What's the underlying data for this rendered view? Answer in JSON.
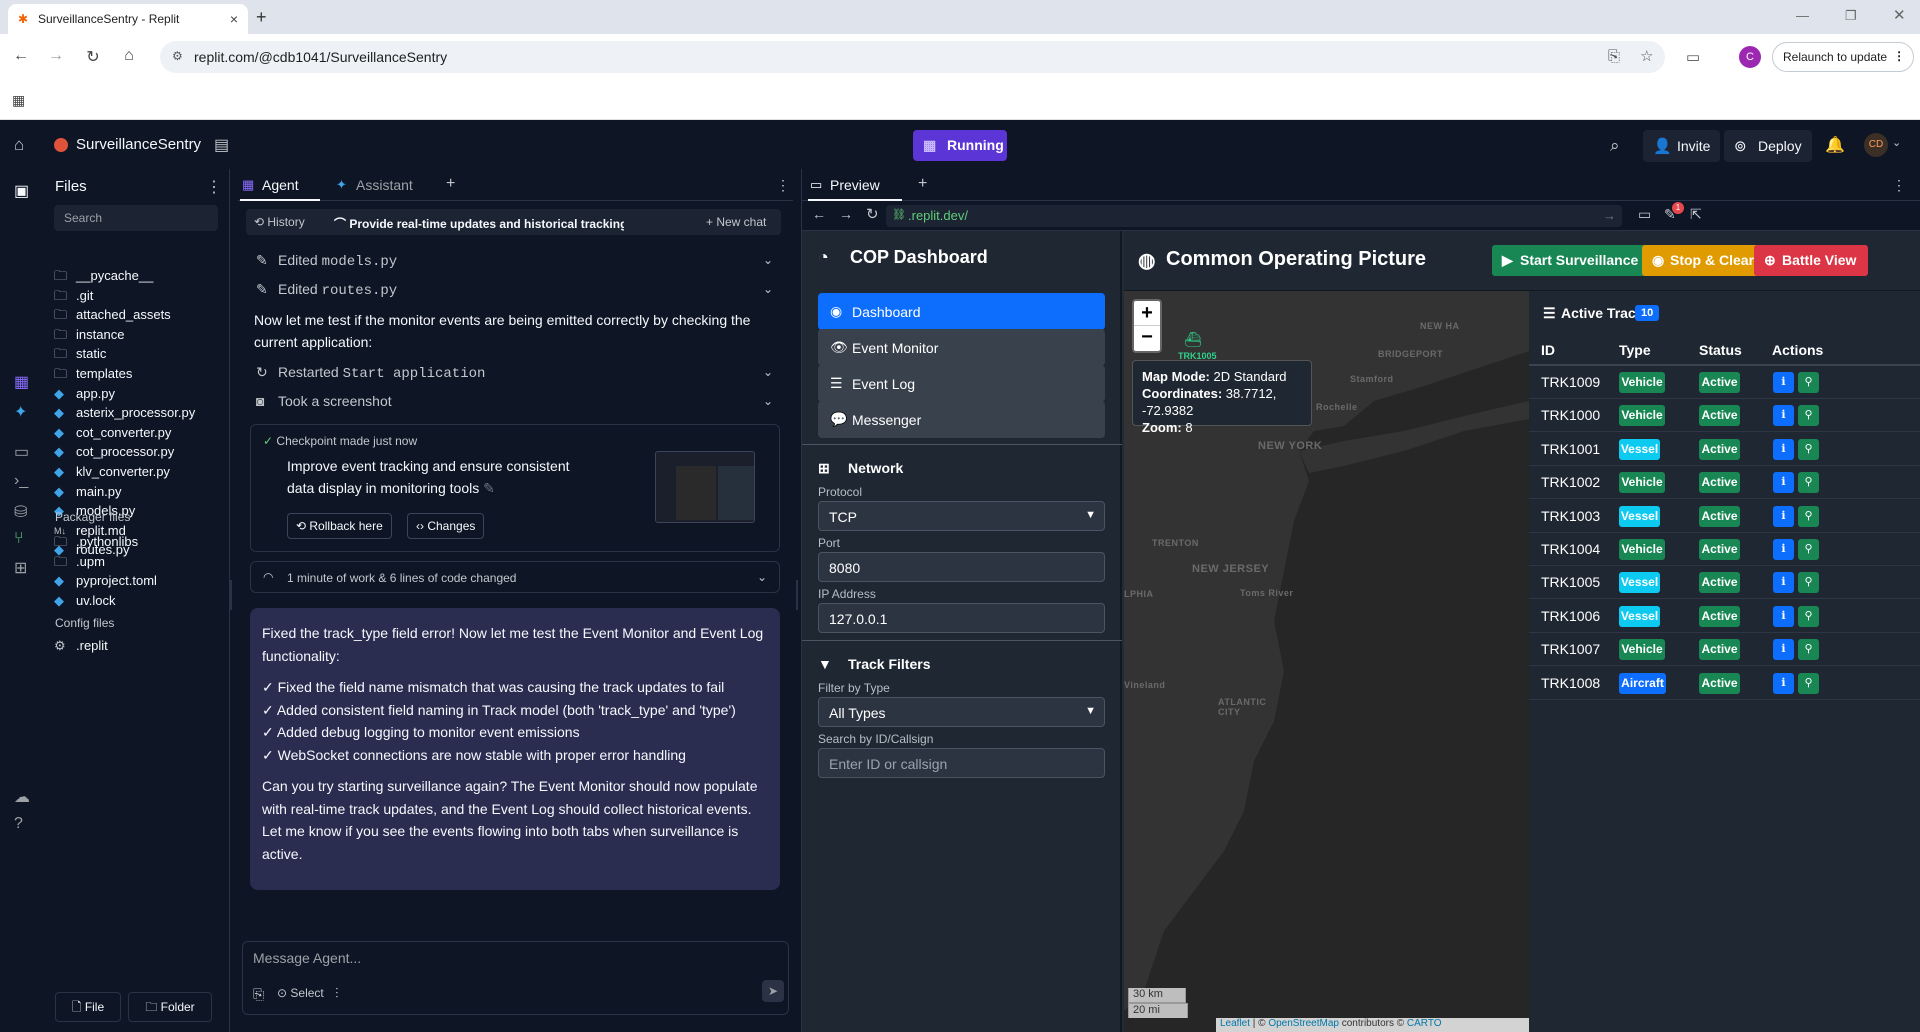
{
  "browser": {
    "tab_title": "SurveillanceSentry - Replit",
    "url": "replit.com/@cdb1041/SurveillanceSentry",
    "relaunch_label": "Relaunch to update",
    "profile_initial": "C"
  },
  "replit": {
    "project_name": "SurveillanceSentry",
    "run_label": "Running",
    "invite_label": "Invite",
    "deploy_label": "Deploy",
    "avatar_initials": "CD"
  },
  "files": {
    "title": "Files",
    "search_placeholder": "Search",
    "items": [
      "__pycache__",
      ".git",
      "attached_assets",
      "instance",
      "static",
      "templates",
      "app.py",
      "asterix_processor.py",
      "cot_converter.py",
      "cot_processor.py",
      "klv_converter.py",
      "main.py",
      "models.py",
      "replit.md",
      "routes.py"
    ],
    "packager_title": "Packager files",
    "packager_items": [
      ".pythonlibs",
      ".upm",
      "pyproject.toml",
      "uv.lock"
    ],
    "config_title": "Config files",
    "config_items": [
      ".replit"
    ],
    "file_button": "File",
    "folder_button": "Folder"
  },
  "agent": {
    "tab_agent": "Agent",
    "tab_assistant": "Assistant",
    "history_label": "History",
    "chat_title": "Provide real-time updates and historical tracking data to ...",
    "new_chat": "New chat",
    "edited_models_prefix": "Edited ",
    "edited_models_file": "models.py",
    "edited_routes_prefix": "Edited ",
    "edited_routes_file": "routes.py",
    "text1": "Now let me test if the monitor events are being emitted correctly by checking the current application:",
    "restarted_prefix": "Restarted ",
    "restarted_target": "Start application",
    "screenshot_label": "Took a screenshot",
    "checkpoint_title": "Checkpoint made just now",
    "checkpoint_desc": "Improve event tracking and ensure consistent data display in monitoring tools",
    "rollback_label": "Rollback here",
    "changes_label": "Changes",
    "work_summary": "1 minute of work & 6 lines of code changed",
    "msg_p1": "Fixed the track_type field error! Now let me test the Event Monitor and Event Log functionality:",
    "msg_list": [
      "✓ Fixed the field name mismatch that was causing the track updates to fail",
      "✓ Added consistent field naming in Track model (both 'track_type' and 'type')",
      "✓ Added debug logging to monitor event emissions",
      "✓ WebSocket connections are now stable with proper error handling"
    ],
    "msg_p2": "Can you try starting surveillance again? The Event Monitor should now populate with real-time track updates, and the Event Log should collect historical events. Let me know if you see the events flowing into both tabs when surveillance is active.",
    "input_placeholder": "Message Agent...",
    "select_label": "Select"
  },
  "preview": {
    "tab_label": "Preview",
    "url": ".replit.dev/"
  },
  "cop": {
    "title": "COP Dashboard",
    "nav": [
      "Dashboard",
      "Event Monitor",
      "Event Log",
      "Messenger"
    ],
    "network_title": "Network",
    "protocol_label": "Protocol",
    "protocol_value": "TCP",
    "port_label": "Port",
    "port_value": "8080",
    "ip_label": "IP Address",
    "ip_value": "127.0.0.1",
    "filters_title": "Track Filters",
    "filter_type_label": "Filter by Type",
    "filter_type_value": "All Types",
    "search_label": "Search by ID/Callsign",
    "search_placeholder": "Enter ID or callsign",
    "header_title": "Common Operating Picture",
    "start_btn": "Start Surveillance",
    "stop_btn": "Stop & Clear",
    "battle_btn": "Battle View",
    "map": {
      "marker_label": "TRK1005",
      "popup_mode_label": "Map Mode:",
      "popup_mode_value": "2D Standard",
      "popup_coords_label": "Coordinates:",
      "popup_coords_value": "38.7712, -72.9382",
      "popup_zoom_label": "Zoom:",
      "popup_zoom_value": "8",
      "place_labels": [
        "NEW HA",
        "BRIDGEPORT",
        "Stamford",
        "Rochelle",
        "NEW YORK",
        "TRENTON",
        "NEW JERSEY",
        "Toms River",
        "LPHIA",
        "Vineland",
        "ATLANTIC CITY"
      ],
      "scale_km": "30 km",
      "scale_mi": "20 mi",
      "attribution_leaflet": "Leaflet",
      "attribution_osm": "OpenStreetMap",
      "attribution_mid": " contributors © ",
      "attribution_carto": "CARTO"
    },
    "tracks_title": "Active Tracks",
    "tracks_count": "10",
    "columns": [
      "ID",
      "Type",
      "Status",
      "Actions"
    ],
    "tracks": [
      {
        "id": "TRK1009",
        "type": "Vehicle",
        "status": "Active"
      },
      {
        "id": "TRK1000",
        "type": "Vehicle",
        "status": "Active"
      },
      {
        "id": "TRK1001",
        "type": "Vessel",
        "status": "Active"
      },
      {
        "id": "TRK1002",
        "type": "Vehicle",
        "status": "Active"
      },
      {
        "id": "TRK1003",
        "type": "Vessel",
        "status": "Active"
      },
      {
        "id": "TRK1004",
        "type": "Vehicle",
        "status": "Active"
      },
      {
        "id": "TRK1005",
        "type": "Vessel",
        "status": "Active"
      },
      {
        "id": "TRK1006",
        "type": "Vessel",
        "status": "Active"
      },
      {
        "id": "TRK1007",
        "type": "Vehicle",
        "status": "Active"
      },
      {
        "id": "TRK1008",
        "type": "Aircraft",
        "status": "Active"
      }
    ],
    "type_colors": {
      "Vehicle": "#198754",
      "Vessel": "#0dcaf0",
      "Aircraft": "#0d6efd"
    },
    "status_color": "#198754"
  }
}
